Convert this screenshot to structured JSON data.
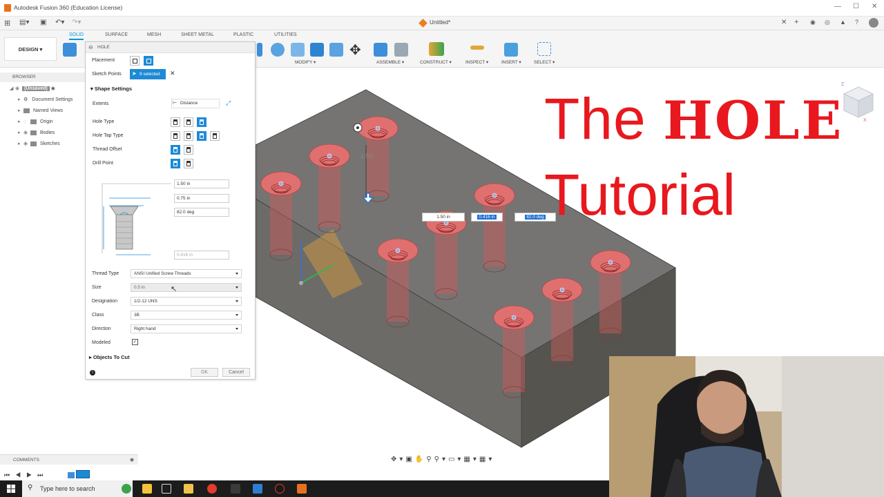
{
  "window": {
    "title": "Autodesk Fusion 360 (Education License)",
    "document_tab": "Untitled*"
  },
  "workspace_tabs": [
    "SOLID",
    "SURFACE",
    "MESH",
    "SHEET METAL",
    "PLASTIC",
    "UTILITIES"
  ],
  "design_label": "DESIGN",
  "toolbar_groups": [
    "MODIFY",
    "ASSEMBLE",
    "CONSTRUCT",
    "INSPECT",
    "INSERT",
    "SELECT"
  ],
  "browser": {
    "header": "BROWSER",
    "items": [
      "(Unsaved)",
      "Document Settings",
      "Named Views",
      "Origin",
      "Bodies",
      "Sketches"
    ]
  },
  "hole_dialog": {
    "title": "HOLE",
    "placement_label": "Placement",
    "sketch_points_label": "Sketch Points",
    "selected_label": "9 selected",
    "shape_settings_label": "Shape Settings",
    "extents_label": "Extents",
    "extents_value": "Distance",
    "hole_type_label": "Hole Type",
    "hole_tap_type_label": "Hole Tap Type",
    "thread_offset_label": "Thread Offset",
    "drill_point_label": "Drill Point",
    "dims": [
      "1.50 in",
      "0.75 in",
      "82.0 deg",
      "0.416 in"
    ],
    "thread_type_label": "Thread Type",
    "thread_type_value": "ANSI Unified Screw Threads",
    "size_label": "Size",
    "size_value": "0.5 in",
    "designation_label": "Designation",
    "designation_value": "1/2-12 UNS",
    "class_label": "Class",
    "class_value": "3B",
    "direction_label": "Direction",
    "direction_value": "Right hand",
    "modeled_label": "Modeled",
    "objects_to_cut_label": "Objects To Cut",
    "ok_label": "OK",
    "cancel_label": "Cancel"
  },
  "viewport": {
    "floating_dims": [
      "1.50 in",
      "0.416 in",
      "82.0 deg"
    ],
    "depth_hint": "1.50"
  },
  "overlay": {
    "line1_a": "The",
    "line1_b": "HOLE",
    "line2": "Tutorial"
  },
  "comments_label": "COMMENTS",
  "taskbar": {
    "search_placeholder": "Type here to search"
  },
  "colors": {
    "accent": "#0696d7",
    "overlay_red": "#e8181e",
    "body_gray": "#6b6a67"
  }
}
